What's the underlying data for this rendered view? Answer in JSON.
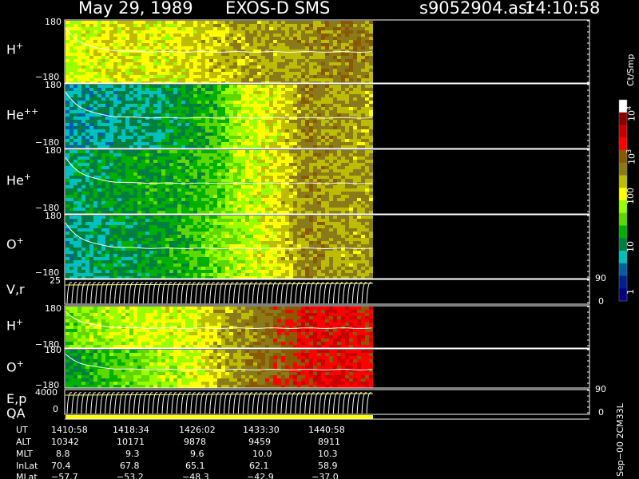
{
  "header": {
    "date": "May 29, 1989",
    "instrument": "EXOS-D SMS",
    "file": "s9052904.asr",
    "time": "14:10:58"
  },
  "panels": [
    {
      "label": "H",
      "charge": "+",
      "ytop": "180",
      "ybot": "−180"
    },
    {
      "label": "He",
      "charge": "++",
      "ytop": "180",
      "ybot": "−180"
    },
    {
      "label": "He",
      "charge": "+",
      "ytop": "180",
      "ybot": "−180"
    },
    {
      "label": "O",
      "charge": "+",
      "ytop": "180",
      "ybot": "−180"
    },
    {
      "label": "V,r",
      "charge": "",
      "ytop": "25",
      "ybot": "",
      "rtop": "90",
      "rbot": "0"
    },
    {
      "label": "H",
      "charge": "+",
      "ytop": "180",
      "ybot": "−180"
    },
    {
      "label": "O",
      "charge": "+",
      "ytop": "180",
      "ybot": "−180"
    },
    {
      "label": "E,p",
      "charge": "",
      "ytop": "4000",
      "ybot": "0",
      "rtop": "90",
      "rbot": "0"
    }
  ],
  "qa_label": "QA",
  "colorbar": {
    "unit": "Ct/Smp",
    "ticks": [
      "10",
      "10",
      "100",
      "10",
      "1"
    ],
    "tick_exponents": [
      "4",
      "3",
      "",
      "",
      ""
    ],
    "colors": [
      "#ffffff",
      "#8b0000",
      "#c80000",
      "#ff0000",
      "#8b5a00",
      "#8b7a1a",
      "#bcbc00",
      "#ffff00",
      "#9aff00",
      "#5fd700",
      "#00b000",
      "#008040",
      "#00c0c0",
      "#0060a0",
      "#002090",
      "#000080"
    ]
  },
  "side_label": "Sep−00 2CM33L",
  "ephemeris": {
    "labels": [
      "UT",
      "ALT",
      "MLT",
      "InLat",
      "MLat"
    ],
    "columns": [
      [
        "1410:58",
        "10342",
        "8.8",
        "70.4",
        "−57.7"
      ],
      [
        "1418:34",
        "10171",
        "9.3",
        "67.8",
        "−53.2"
      ],
      [
        "1426:02",
        "9878",
        "9.6",
        "65.1",
        "−48.3"
      ],
      [
        "1433:30",
        "9459",
        "10.0",
        "62.1",
        "−42.9"
      ],
      [
        "1440:58",
        "8911",
        "10.3",
        "58.9",
        "−37.0"
      ]
    ]
  },
  "chart_data": {
    "type": "heatmap",
    "x_ticks": [
      "1410:58",
      "1418:34",
      "1426:02",
      "1433:30",
      "1440:58"
    ],
    "color_scale": "log",
    "color_range": [
      1,
      10000
    ],
    "panels": [
      {
        "name": "H+",
        "ylim": [
          -180,
          180
        ],
        "level_profile": [
          90,
          120,
          150,
          160,
          140,
          150,
          180,
          250,
          300,
          320,
          340,
          380,
          450,
          500,
          400
        ]
      },
      {
        "name": "He++",
        "ylim": [
          -180,
          180
        ],
        "level_profile": [
          6,
          7,
          8,
          9,
          10,
          14,
          18,
          30,
          80,
          120,
          200,
          450,
          350,
          330,
          320
        ]
      },
      {
        "name": "He+",
        "ylim": [
          -180,
          180
        ],
        "level_profile": [
          10,
          12,
          14,
          16,
          18,
          20,
          25,
          40,
          80,
          130,
          200,
          450,
          350,
          330,
          320
        ]
      },
      {
        "name": "O+",
        "ylim": [
          -180,
          180
        ],
        "level_profile": [
          8,
          9,
          11,
          13,
          16,
          20,
          30,
          50,
          80,
          130,
          200,
          450,
          350,
          330,
          320
        ]
      },
      {
        "name": "H+ (2)",
        "ylim": [
          -180,
          180
        ],
        "level_profile": [
          40,
          60,
          80,
          90,
          100,
          120,
          150,
          250,
          400,
          600,
          1000,
          1800,
          2000,
          1800,
          1500
        ]
      },
      {
        "name": "O+ (2)",
        "ylim": [
          -180,
          180
        ],
        "level_profile": [
          15,
          20,
          30,
          40,
          60,
          80,
          120,
          250,
          400,
          600,
          1000,
          1800,
          2000,
          1800,
          1500
        ]
      }
    ]
  }
}
